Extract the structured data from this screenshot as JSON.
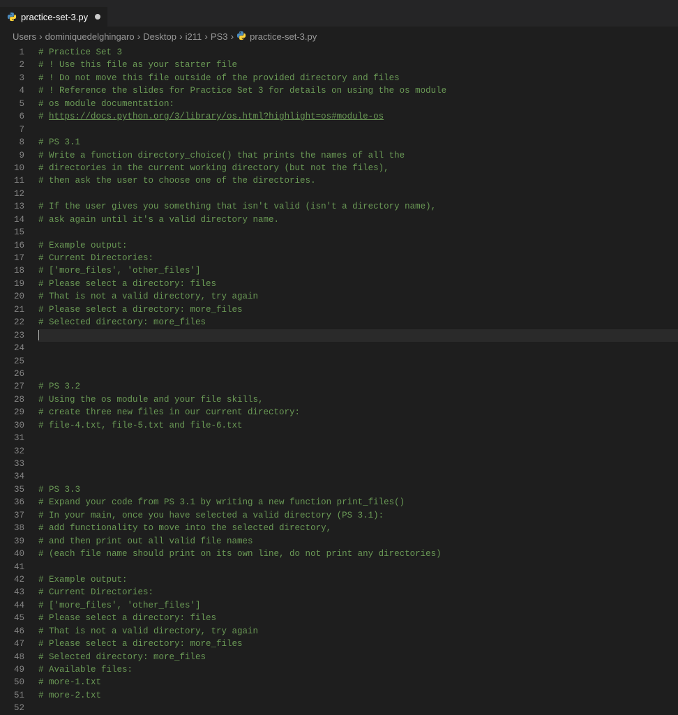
{
  "tab": {
    "label": "practice-set-3.py",
    "dirty": true
  },
  "breadcrumbs": {
    "segments": [
      "Users",
      "dominiquedelghingaro",
      "Desktop",
      "i211",
      "PS3"
    ],
    "file": "practice-set-3.py"
  },
  "editor": {
    "current_line": 23,
    "lines": [
      {
        "n": 1,
        "t": "# Practice Set 3",
        "c": "comment"
      },
      {
        "n": 2,
        "t": "# ! Use this file as your starter file",
        "c": "comment"
      },
      {
        "n": 3,
        "t": "# ! Do not move this file outside of the provided directory and files",
        "c": "comment"
      },
      {
        "n": 4,
        "t": "# ! Reference the slides for Practice Set 3 for details on using the os module",
        "c": "comment"
      },
      {
        "n": 5,
        "t": "# os module documentation:",
        "c": "comment"
      },
      {
        "n": 6,
        "t": "# ",
        "c": "comment",
        "link": "https://docs.python.org/3/library/os.html?highlight=os#module-os"
      },
      {
        "n": 7,
        "t": "",
        "c": ""
      },
      {
        "n": 8,
        "t": "# PS 3.1",
        "c": "comment"
      },
      {
        "n": 9,
        "t": "# Write a function directory_choice() that prints the names of all the",
        "c": "comment"
      },
      {
        "n": 10,
        "t": "# directories in the current working directory (but not the files),",
        "c": "comment"
      },
      {
        "n": 11,
        "t": "# then ask the user to choose one of the directories.",
        "c": "comment"
      },
      {
        "n": 12,
        "t": "",
        "c": ""
      },
      {
        "n": 13,
        "t": "# If the user gives you something that isn't valid (isn't a directory name),",
        "c": "comment"
      },
      {
        "n": 14,
        "t": "# ask again until it's a valid directory name.",
        "c": "comment"
      },
      {
        "n": 15,
        "t": "",
        "c": ""
      },
      {
        "n": 16,
        "t": "# Example output:",
        "c": "comment"
      },
      {
        "n": 17,
        "t": "# Current Directories:",
        "c": "comment"
      },
      {
        "n": 18,
        "t": "# ['more_files', 'other_files']",
        "c": "comment"
      },
      {
        "n": 19,
        "t": "# Please select a directory: files",
        "c": "comment"
      },
      {
        "n": 20,
        "t": "# That is not a valid directory, try again",
        "c": "comment"
      },
      {
        "n": 21,
        "t": "# Please select a directory: more_files",
        "c": "comment"
      },
      {
        "n": 22,
        "t": "# Selected directory: more_files",
        "c": "comment"
      },
      {
        "n": 23,
        "t": "",
        "c": "",
        "cursor": true
      },
      {
        "n": 24,
        "t": "",
        "c": ""
      },
      {
        "n": 25,
        "t": "",
        "c": ""
      },
      {
        "n": 26,
        "t": "",
        "c": ""
      },
      {
        "n": 27,
        "t": "# PS 3.2",
        "c": "comment"
      },
      {
        "n": 28,
        "t": "# Using the os module and your file skills,",
        "c": "comment"
      },
      {
        "n": 29,
        "t": "# create three new files in our current directory:",
        "c": "comment"
      },
      {
        "n": 30,
        "t": "# file-4.txt, file-5.txt and file-6.txt",
        "c": "comment"
      },
      {
        "n": 31,
        "t": "",
        "c": ""
      },
      {
        "n": 32,
        "t": "",
        "c": ""
      },
      {
        "n": 33,
        "t": "",
        "c": ""
      },
      {
        "n": 34,
        "t": "",
        "c": ""
      },
      {
        "n": 35,
        "t": "# PS 3.3",
        "c": "comment"
      },
      {
        "n": 36,
        "t": "# Expand your code from PS 3.1 by writing a new function print_files()",
        "c": "comment"
      },
      {
        "n": 37,
        "t": "# In your main, once you have selected a valid directory (PS 3.1):",
        "c": "comment"
      },
      {
        "n": 38,
        "t": "# add functionality to move into the selected directory,",
        "c": "comment"
      },
      {
        "n": 39,
        "t": "# and then print out all valid file names",
        "c": "comment"
      },
      {
        "n": 40,
        "t": "# (each file name should print on its own line, do not print any directories)",
        "c": "comment"
      },
      {
        "n": 41,
        "t": "",
        "c": ""
      },
      {
        "n": 42,
        "t": "# Example output:",
        "c": "comment"
      },
      {
        "n": 43,
        "t": "# Current Directories:",
        "c": "comment"
      },
      {
        "n": 44,
        "t": "# ['more_files', 'other_files']",
        "c": "comment"
      },
      {
        "n": 45,
        "t": "# Please select a directory: files",
        "c": "comment"
      },
      {
        "n": 46,
        "t": "# That is not a valid directory, try again",
        "c": "comment"
      },
      {
        "n": 47,
        "t": "# Please select a directory: more_files",
        "c": "comment"
      },
      {
        "n": 48,
        "t": "# Selected directory: more_files",
        "c": "comment"
      },
      {
        "n": 49,
        "t": "# Available files:",
        "c": "comment"
      },
      {
        "n": 50,
        "t": "# more-1.txt",
        "c": "comment"
      },
      {
        "n": 51,
        "t": "# more-2.txt",
        "c": "comment"
      },
      {
        "n": 52,
        "t": "",
        "c": ""
      }
    ]
  }
}
